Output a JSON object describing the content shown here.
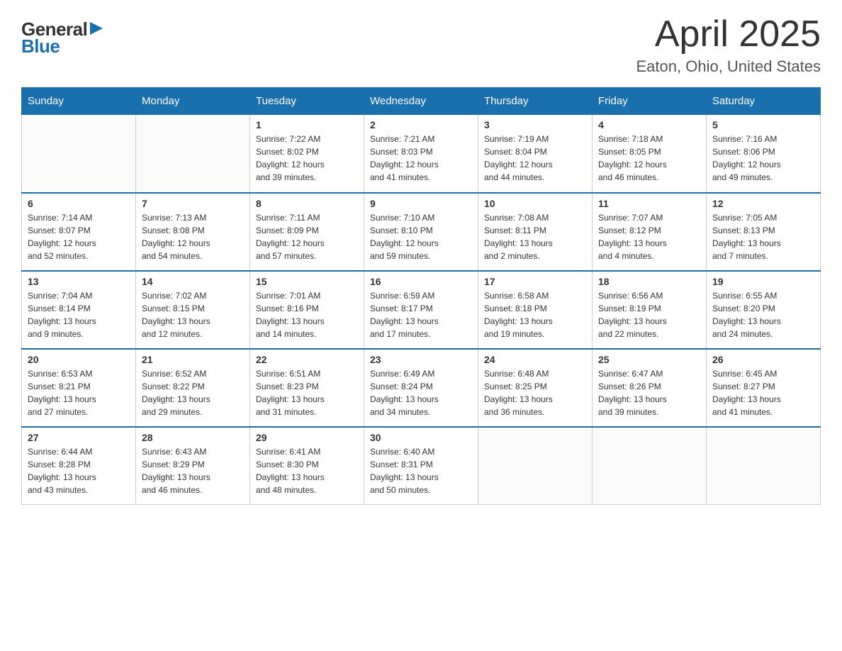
{
  "logo": {
    "text_general": "General",
    "text_blue": "Blue"
  },
  "header": {
    "title": "April 2025",
    "subtitle": "Eaton, Ohio, United States"
  },
  "days_of_week": [
    "Sunday",
    "Monday",
    "Tuesday",
    "Wednesday",
    "Thursday",
    "Friday",
    "Saturday"
  ],
  "weeks": [
    [
      {
        "day": "",
        "info": ""
      },
      {
        "day": "",
        "info": ""
      },
      {
        "day": "1",
        "info": "Sunrise: 7:22 AM\nSunset: 8:02 PM\nDaylight: 12 hours\nand 39 minutes."
      },
      {
        "day": "2",
        "info": "Sunrise: 7:21 AM\nSunset: 8:03 PM\nDaylight: 12 hours\nand 41 minutes."
      },
      {
        "day": "3",
        "info": "Sunrise: 7:19 AM\nSunset: 8:04 PM\nDaylight: 12 hours\nand 44 minutes."
      },
      {
        "day": "4",
        "info": "Sunrise: 7:18 AM\nSunset: 8:05 PM\nDaylight: 12 hours\nand 46 minutes."
      },
      {
        "day": "5",
        "info": "Sunrise: 7:16 AM\nSunset: 8:06 PM\nDaylight: 12 hours\nand 49 minutes."
      }
    ],
    [
      {
        "day": "6",
        "info": "Sunrise: 7:14 AM\nSunset: 8:07 PM\nDaylight: 12 hours\nand 52 minutes."
      },
      {
        "day": "7",
        "info": "Sunrise: 7:13 AM\nSunset: 8:08 PM\nDaylight: 12 hours\nand 54 minutes."
      },
      {
        "day": "8",
        "info": "Sunrise: 7:11 AM\nSunset: 8:09 PM\nDaylight: 12 hours\nand 57 minutes."
      },
      {
        "day": "9",
        "info": "Sunrise: 7:10 AM\nSunset: 8:10 PM\nDaylight: 12 hours\nand 59 minutes."
      },
      {
        "day": "10",
        "info": "Sunrise: 7:08 AM\nSunset: 8:11 PM\nDaylight: 13 hours\nand 2 minutes."
      },
      {
        "day": "11",
        "info": "Sunrise: 7:07 AM\nSunset: 8:12 PM\nDaylight: 13 hours\nand 4 minutes."
      },
      {
        "day": "12",
        "info": "Sunrise: 7:05 AM\nSunset: 8:13 PM\nDaylight: 13 hours\nand 7 minutes."
      }
    ],
    [
      {
        "day": "13",
        "info": "Sunrise: 7:04 AM\nSunset: 8:14 PM\nDaylight: 13 hours\nand 9 minutes."
      },
      {
        "day": "14",
        "info": "Sunrise: 7:02 AM\nSunset: 8:15 PM\nDaylight: 13 hours\nand 12 minutes."
      },
      {
        "day": "15",
        "info": "Sunrise: 7:01 AM\nSunset: 8:16 PM\nDaylight: 13 hours\nand 14 minutes."
      },
      {
        "day": "16",
        "info": "Sunrise: 6:59 AM\nSunset: 8:17 PM\nDaylight: 13 hours\nand 17 minutes."
      },
      {
        "day": "17",
        "info": "Sunrise: 6:58 AM\nSunset: 8:18 PM\nDaylight: 13 hours\nand 19 minutes."
      },
      {
        "day": "18",
        "info": "Sunrise: 6:56 AM\nSunset: 8:19 PM\nDaylight: 13 hours\nand 22 minutes."
      },
      {
        "day": "19",
        "info": "Sunrise: 6:55 AM\nSunset: 8:20 PM\nDaylight: 13 hours\nand 24 minutes."
      }
    ],
    [
      {
        "day": "20",
        "info": "Sunrise: 6:53 AM\nSunset: 8:21 PM\nDaylight: 13 hours\nand 27 minutes."
      },
      {
        "day": "21",
        "info": "Sunrise: 6:52 AM\nSunset: 8:22 PM\nDaylight: 13 hours\nand 29 minutes."
      },
      {
        "day": "22",
        "info": "Sunrise: 6:51 AM\nSunset: 8:23 PM\nDaylight: 13 hours\nand 31 minutes."
      },
      {
        "day": "23",
        "info": "Sunrise: 6:49 AM\nSunset: 8:24 PM\nDaylight: 13 hours\nand 34 minutes."
      },
      {
        "day": "24",
        "info": "Sunrise: 6:48 AM\nSunset: 8:25 PM\nDaylight: 13 hours\nand 36 minutes."
      },
      {
        "day": "25",
        "info": "Sunrise: 6:47 AM\nSunset: 8:26 PM\nDaylight: 13 hours\nand 39 minutes."
      },
      {
        "day": "26",
        "info": "Sunrise: 6:45 AM\nSunset: 8:27 PM\nDaylight: 13 hours\nand 41 minutes."
      }
    ],
    [
      {
        "day": "27",
        "info": "Sunrise: 6:44 AM\nSunset: 8:28 PM\nDaylight: 13 hours\nand 43 minutes."
      },
      {
        "day": "28",
        "info": "Sunrise: 6:43 AM\nSunset: 8:29 PM\nDaylight: 13 hours\nand 46 minutes."
      },
      {
        "day": "29",
        "info": "Sunrise: 6:41 AM\nSunset: 8:30 PM\nDaylight: 13 hours\nand 48 minutes."
      },
      {
        "day": "30",
        "info": "Sunrise: 6:40 AM\nSunset: 8:31 PM\nDaylight: 13 hours\nand 50 minutes."
      },
      {
        "day": "",
        "info": ""
      },
      {
        "day": "",
        "info": ""
      },
      {
        "day": "",
        "info": ""
      }
    ]
  ]
}
